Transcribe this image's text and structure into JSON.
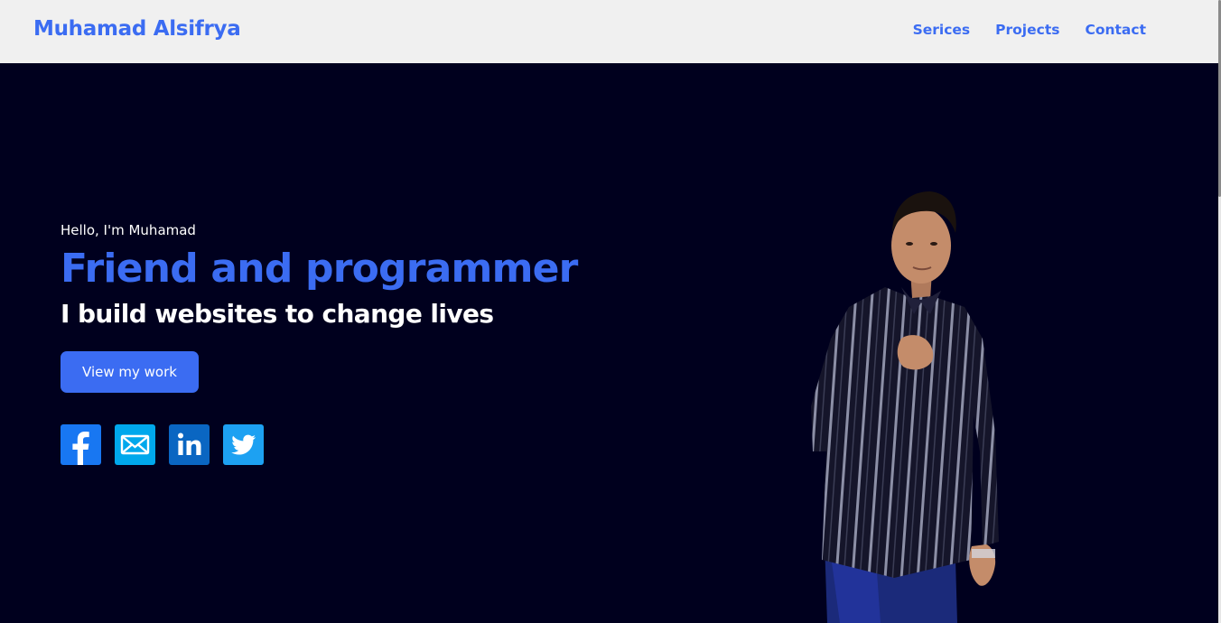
{
  "header": {
    "logo": "Muhamad Alsifrya",
    "nav": [
      "Serices",
      "Projects",
      "Contact"
    ]
  },
  "hero": {
    "greeting": "Hello, I'm Muhamad",
    "headline": "Friend and programmer",
    "subheadline": "I build websites to change lives",
    "cta_label": "View my work"
  },
  "socials": [
    {
      "name": "facebook",
      "icon": "facebook-icon",
      "color": "#1877f2"
    },
    {
      "name": "email",
      "icon": "envelope-icon",
      "color": "#00a8ec"
    },
    {
      "name": "linkedin",
      "icon": "linkedin-icon",
      "color": "#0a66c2"
    },
    {
      "name": "twitter",
      "icon": "twitter-icon",
      "color": "#1da1f2"
    }
  ],
  "colors": {
    "accent": "#3b6cf2",
    "background": "#00001e",
    "header_bg": "#f0f0f0"
  }
}
